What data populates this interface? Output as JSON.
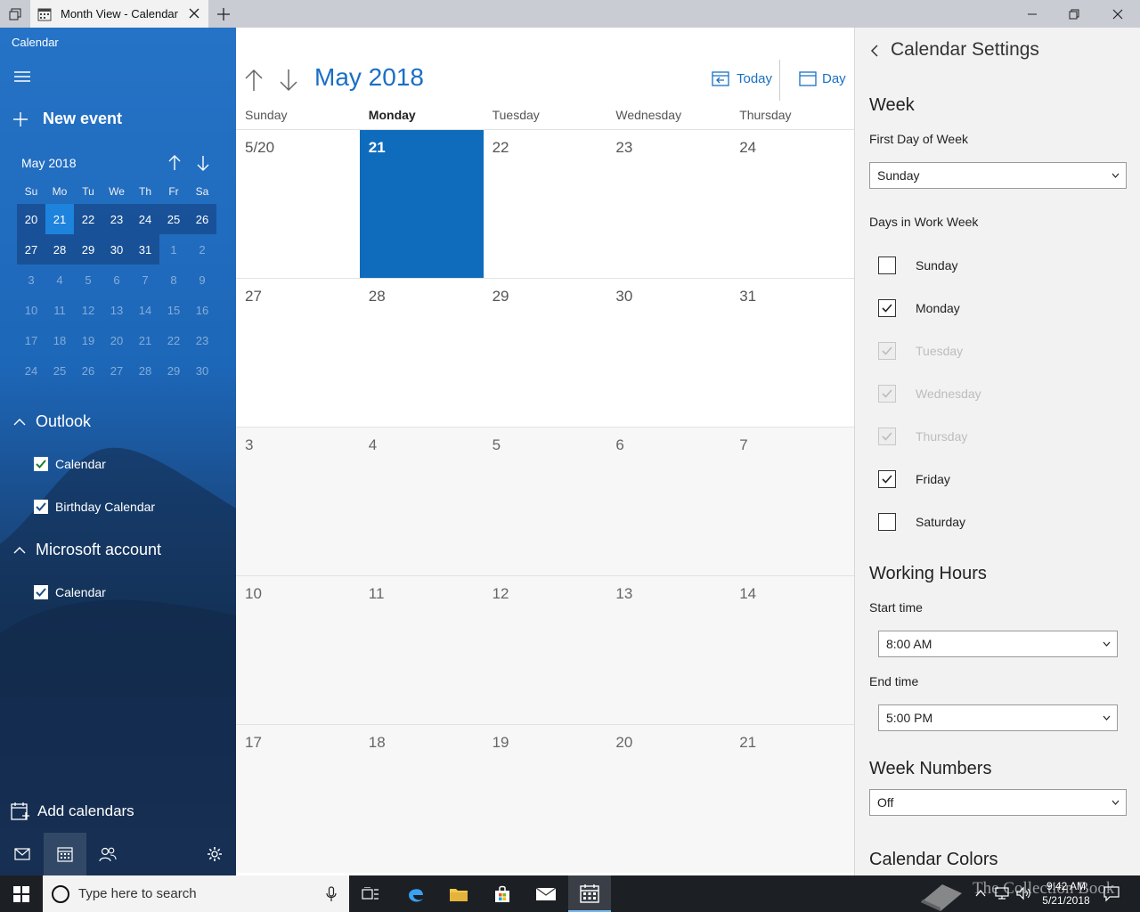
{
  "window": {
    "tab_title": "Month View - Calendar"
  },
  "sidebar": {
    "app_name": "Calendar",
    "new_event": "New event",
    "mini_calendar": {
      "month_label": "May 2018",
      "dow": [
        "Su",
        "Mo",
        "Tu",
        "We",
        "Th",
        "Fr",
        "Sa"
      ],
      "weeks": [
        [
          "20",
          "21",
          "22",
          "23",
          "24",
          "25",
          "26"
        ],
        [
          "27",
          "28",
          "29",
          "30",
          "31",
          "1",
          "2"
        ],
        [
          "3",
          "4",
          "5",
          "6",
          "7",
          "8",
          "9"
        ],
        [
          "10",
          "11",
          "12",
          "13",
          "14",
          "15",
          "16"
        ],
        [
          "17",
          "18",
          "19",
          "20",
          "21",
          "22",
          "23"
        ],
        [
          "24",
          "25",
          "26",
          "27",
          "28",
          "29",
          "30"
        ]
      ],
      "today": "21"
    },
    "groups": [
      {
        "name": "Outlook",
        "calendars": [
          "Calendar",
          "Birthday Calendar"
        ]
      },
      {
        "name": "Microsoft account",
        "calendars": [
          "Calendar"
        ]
      }
    ],
    "add_calendars": "Add calendars"
  },
  "main": {
    "month_title": "May 2018",
    "today_label": "Today",
    "view_label": "Day",
    "day_headers": [
      "Sunday",
      "Monday",
      "Tuesday",
      "Wednesday",
      "Thursday"
    ],
    "current_day_header": "Monday",
    "weeks": [
      [
        "5/20",
        "21",
        "22",
        "23",
        "24"
      ],
      [
        "27",
        "28",
        "29",
        "30",
        "31"
      ],
      [
        "3",
        "4",
        "5",
        "6",
        "7"
      ],
      [
        "10",
        "11",
        "12",
        "13",
        "14"
      ],
      [
        "17",
        "18",
        "19",
        "20",
        "21"
      ]
    ],
    "selected_day": "21"
  },
  "settings": {
    "title": "Calendar Settings",
    "week_section": "Week",
    "first_day_label": "First Day of Week",
    "first_day_value": "Sunday",
    "work_week_label": "Days in Work Week",
    "days": [
      {
        "name": "Sunday",
        "checked": false,
        "disabled": false
      },
      {
        "name": "Monday",
        "checked": true,
        "disabled": false
      },
      {
        "name": "Tuesday",
        "checked": true,
        "disabled": true
      },
      {
        "name": "Wednesday",
        "checked": true,
        "disabled": true
      },
      {
        "name": "Thursday",
        "checked": true,
        "disabled": true
      },
      {
        "name": "Friday",
        "checked": true,
        "disabled": false
      },
      {
        "name": "Saturday",
        "checked": false,
        "disabled": false
      }
    ],
    "working_hours": "Working Hours",
    "start_label": "Start time",
    "start_value": "8:00 AM",
    "end_label": "End time",
    "end_value": "5:00 PM",
    "week_numbers": "Week Numbers",
    "week_numbers_value": "Off",
    "calendar_colors": "Calendar Colors"
  },
  "taskbar": {
    "search_placeholder": "Type here to search",
    "time": "9:42 AM",
    "date": "5/21/2018",
    "watermark": "The Collection Book"
  },
  "colors": {
    "accent": "#0f6cbd",
    "month_title": "#1a6fc4"
  }
}
